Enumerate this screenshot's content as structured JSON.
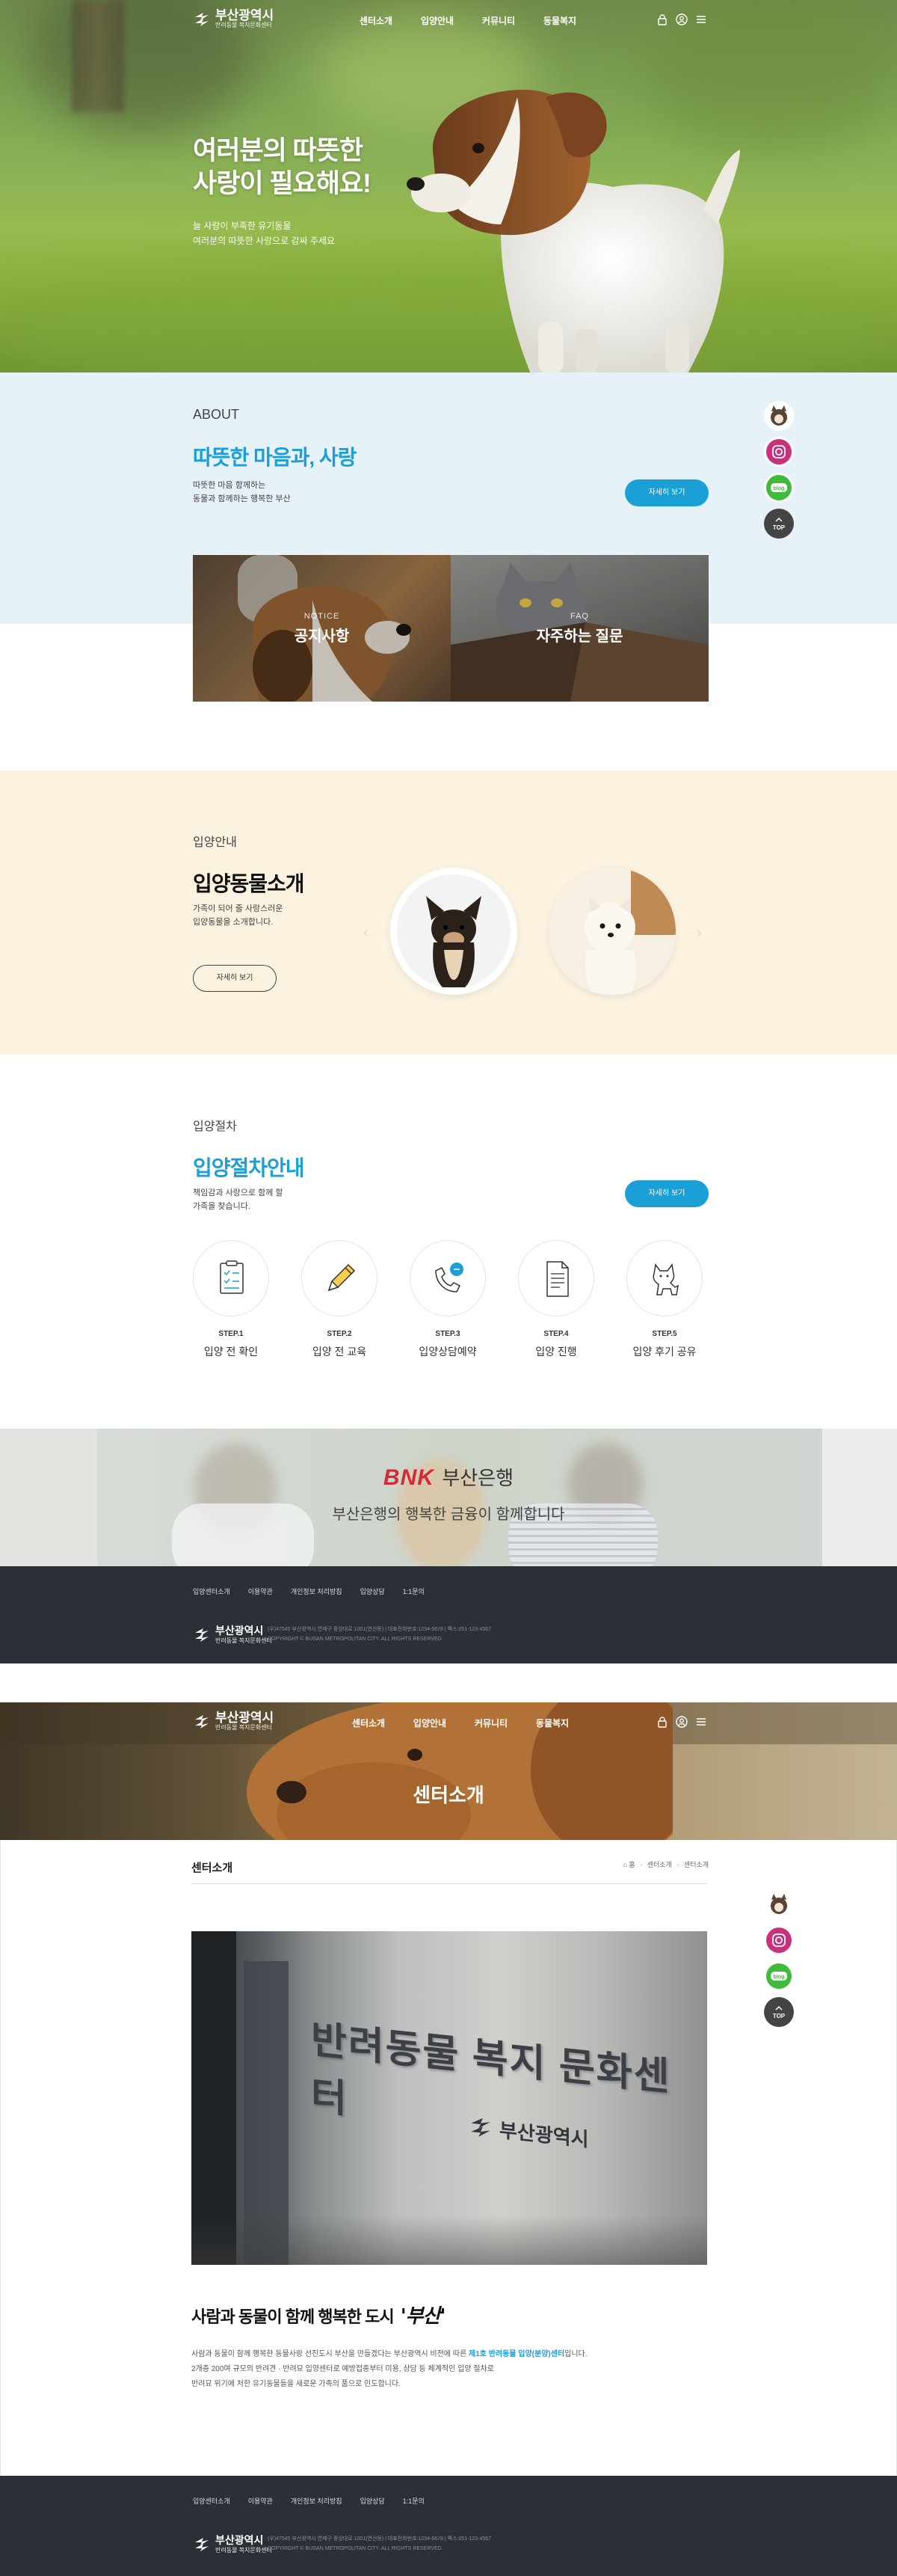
{
  "header": {
    "logo_title": "부산광역시",
    "logo_sub": "반려동물 복지문화센터",
    "nav": [
      "센터소개",
      "입양안내",
      "커뮤니티",
      "동물복지"
    ]
  },
  "hero": {
    "title_line1": "여러분의 따뜻한",
    "title_line2": "사랑이 필요해요!",
    "desc_line1": "늘 사랑이 부족한 유기동물",
    "desc_line2": "여러분의 따뜻한 사랑으로 감싸 주세요"
  },
  "about": {
    "label": "ABOUT",
    "title": "따뜻한 마음과, 사랑",
    "desc_line1": "따뜻한 마음 함께하는",
    "desc_line2": "동물과 함께하는 행복한 부산",
    "button": "자세히 보기"
  },
  "cards": [
    {
      "en": "NOTICE",
      "ko": "공지사항"
    },
    {
      "en": "FAQ",
      "ko": "자주하는 질문"
    }
  ],
  "adopt": {
    "label": "입양안내",
    "title": "입양동물소개",
    "desc_line1": "가족이 되어 줄 사랑스러운",
    "desc_line2": "입양동물을 소개합니다.",
    "button": "자세히 보기"
  },
  "procedure": {
    "label": "입양절차",
    "title": "입양절차안내",
    "desc_line1": "책임감과 사랑으로 함께 할",
    "desc_line2": "가족을 찾습니다.",
    "button": "자세히 보기",
    "steps": [
      {
        "no": "STEP.1",
        "text": "입양 전 확인",
        "icon": "checklist-icon"
      },
      {
        "no": "STEP.2",
        "text": "입양 전 교육",
        "icon": "pencil-icon"
      },
      {
        "no": "STEP.3",
        "text": "입양상담예약",
        "icon": "phone-icon"
      },
      {
        "no": "STEP.4",
        "text": "입양 진행",
        "icon": "document-icon"
      },
      {
        "no": "STEP.5",
        "text": "입양 후기 공유",
        "icon": "dog-icon"
      }
    ]
  },
  "banner": {
    "brand": "BNK",
    "bank": "부산은행",
    "text": "부산은행의 행복한 금융이 함께합니다"
  },
  "footer": {
    "links": [
      "입양센터소개",
      "이용약관",
      "개인정보 처리방침",
      "입양상담",
      "1:1문의"
    ],
    "addr1": "(우)47545 부산광역시 연제구 중앙대로 1001(연산동) | 대표전화번호:1234-5678 | 팩스:051-123-4567",
    "addr2": "COPYRIGHT © BUSAN METROPOLITAN CITY. ALL RIGHTS RESERVED."
  },
  "quick": {
    "instagram": "instagram",
    "blog": "blog",
    "top": "TOP"
  },
  "subpage": {
    "visual_title": "센터소개",
    "page_title": "센터소개",
    "crumb": [
      "홈",
      "센터소개",
      "센터소개"
    ],
    "photo_sign": "반려동물 복지 문화센터",
    "photo_logo": "부산광역시",
    "headline_pre": "사람과 동물이 함께 행복한 도시",
    "headline_city": "'부산'",
    "body_line1_a": "사람과 동물이 함께 행복한 동물사랑 선진도시 부산을 만들겠다는 부산광역시 비전에 따른",
    "body_line1_b": "제1호 반려동물 입양(분양)센터",
    "body_line1_c": "입니다.",
    "body_line2": "2개층 200여 규모의 반려견 · 반려묘 입양센터로 예방접종부터 미용, 상담 등 체계적인 입양 절차로",
    "body_line3": "반려묘 위기에 처한 유기동물들을 새로운 가족의 품으로 인도합니다."
  }
}
